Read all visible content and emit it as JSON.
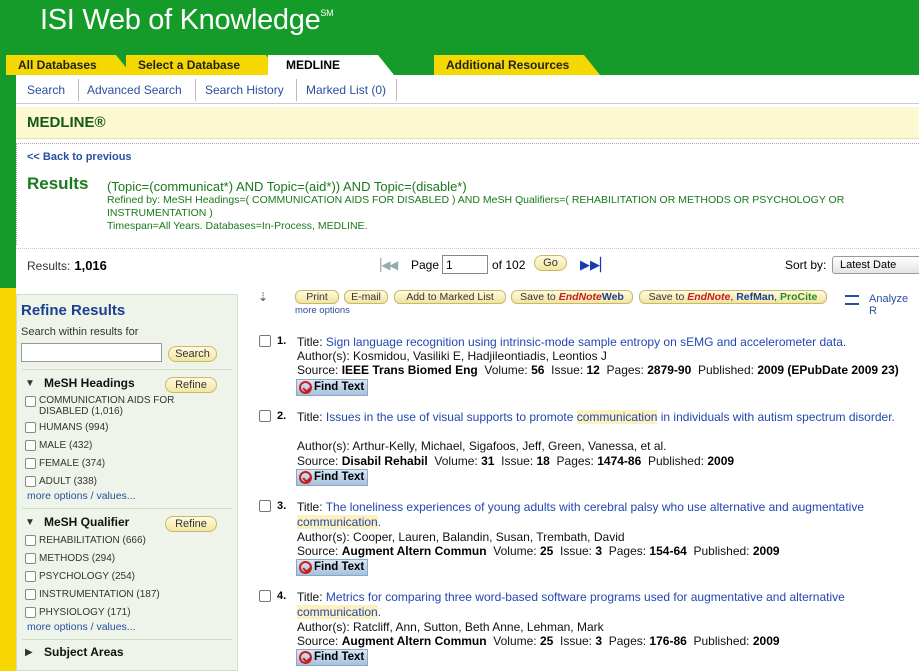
{
  "header": {
    "brand": "ISI Web of Knowledge",
    "brand_mark": "SM"
  },
  "tabs": [
    "All Databases",
    "Select a Database",
    "MEDLINE",
    "Additional Resources"
  ],
  "subnav": [
    "Search",
    "Advanced Search",
    "Search History",
    "Marked List (0)"
  ],
  "db_title": "MEDLINE®",
  "back_link": "<< Back to previous",
  "results_heading": "Results",
  "query": "(Topic=(communicat*) AND Topic=(aid*)) AND Topic=(disable*)",
  "refined_by": "Refined by: MeSH Headings=( COMMUNICATION AIDS FOR DISABLED ) AND MeSH Qualifiers=( REHABILITATION OR METHODS OR PSYCHOLOGY OR INSTRUMENTATION )",
  "timespan": "Timespan=All Years. Databases=In-Process, MEDLINE.",
  "results_label": "Results:",
  "results_count": "1,016",
  "pager": {
    "page_label": "Page",
    "page_value": "1",
    "of_label": "of 102",
    "go_label": "Go"
  },
  "sort": {
    "label": "Sort by:",
    "value": "Latest Date"
  },
  "refine": {
    "title": "Refine Results",
    "search_within": "Search within results for",
    "search_button": "Search",
    "refine_button": "Refine",
    "mesh_headings": {
      "title": "MeSH Headings",
      "items": [
        "COMMUNICATION AIDS FOR DISABLED (1,016)",
        "HUMANS (994)",
        "MALE (432)",
        "FEMALE (374)",
        "ADULT (338)"
      ],
      "more": "more options / values..."
    },
    "mesh_qualifier": {
      "title": "MeSH Qualifier",
      "items": [
        "REHABILITATION (666)",
        "METHODS (294)",
        "PSYCHOLOGY (254)",
        "INSTRUMENTATION (187)",
        "PHYSIOLOGY (171)"
      ],
      "more": "more options / values..."
    },
    "subject_areas": "Subject Areas"
  },
  "toolbar": {
    "print": "Print",
    "email": "E-mail",
    "marked": "Add to Marked List",
    "save_to": "Save to",
    "endnote": "EndNote",
    "web": "Web",
    "save_to2": "Save to",
    "endnote2": "EndNote",
    "refman": "RefMan",
    "procite": "ProCite",
    "more": "more options",
    "analyze": "Analyze R"
  },
  "labels": {
    "title": "Title:",
    "authors": "Author(s):",
    "source": "Source:",
    "volume": "Volume:",
    "issue": "Issue:",
    "pages": "Pages:",
    "published": "Published:",
    "find_text": "Find Text"
  },
  "records": [
    {
      "num": "1.",
      "title_a": "Sign language recognition using intrinsic-mode sample entropy on sEMG and accelerometer data.",
      "title_hl": "",
      "title_b": "",
      "authors": "Kosmidou, Vasiliki E, Hadjileontiadis, Leontios J",
      "source": "IEEE Trans Biomed Eng",
      "volume": "56",
      "issue": "12",
      "pages": "2879-90",
      "published": "2009 (EPubDate 2009 23)"
    },
    {
      "num": "2.",
      "title_a": "Issues in the use of visual supports to promote ",
      "title_hl": "communication",
      "title_b": " in individuals with autism spectrum disorder.",
      "authors": "Arthur-Kelly, Michael, Sigafoos, Jeff, Green, Vanessa, et al.",
      "source": "Disabil Rehabil",
      "volume": "31",
      "issue": "18",
      "pages": "1474-86",
      "published": "2009"
    },
    {
      "num": "3.",
      "title_a": "The loneliness experiences of young adults with cerebral palsy who use alternative and augmentative ",
      "title_hl": "communication",
      "title_b": ".",
      "authors": "Cooper, Lauren, Balandin, Susan, Trembath, David",
      "source": "Augment Altern Commun",
      "volume": "25",
      "issue": "3",
      "pages": "154-64",
      "published": "2009"
    },
    {
      "num": "4.",
      "title_a": "Metrics for comparing three word-based software programs used for augmentative and alternative ",
      "title_hl": "communication",
      "title_b": ".",
      "authors": "Ratcliff, Ann, Sutton, Beth Anne, Lehman, Mark",
      "source": "Augment Altern Commun",
      "volume": "25",
      "issue": "3",
      "pages": "176-86",
      "published": "2009"
    }
  ]
}
